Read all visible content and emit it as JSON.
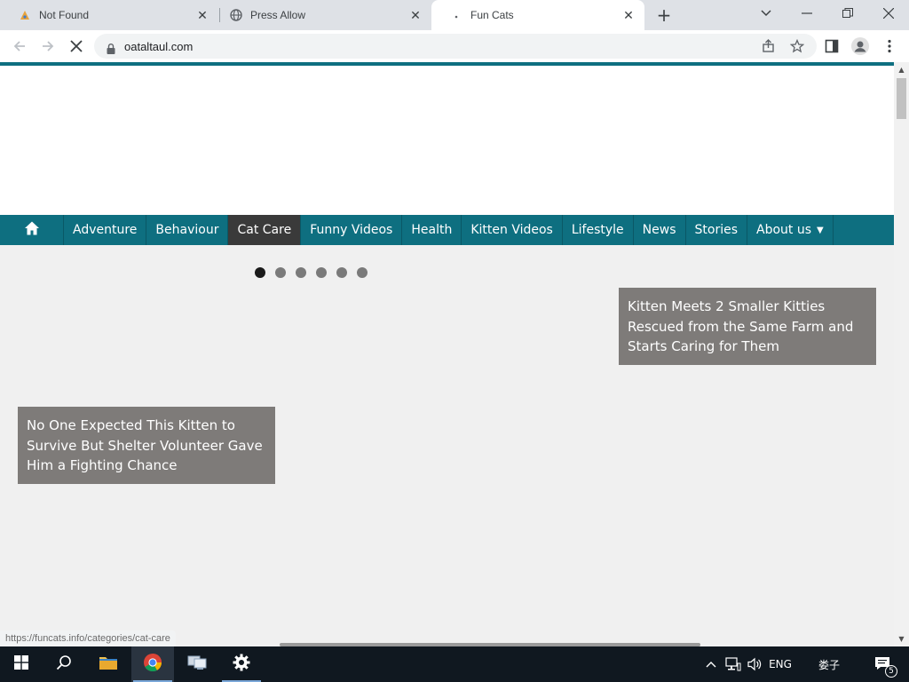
{
  "browser": {
    "tabs": [
      {
        "title": "Not Found",
        "icon": "error-page-icon"
      },
      {
        "title": "Press Allow",
        "icon": "globe-icon"
      },
      {
        "title": "Fun Cats",
        "icon": "loading-icon",
        "active": true
      }
    ],
    "url": "oataltaul.com",
    "status_url": "https://funcats.info/categories/cat-care"
  },
  "page": {
    "nav": {
      "items": [
        "Adventure",
        "Behaviour",
        "Cat Care",
        "Funny Videos",
        "Health",
        "Kitten Videos",
        "Lifestyle",
        "News",
        "Stories",
        "About us"
      ],
      "active": "Cat Care",
      "accent": "#0e6f80"
    },
    "slider": {
      "dots": 6,
      "active_dot": 1
    },
    "captions": [
      "Kitten Meets 2 Smaller Kitties Rescued from the Same Farm and Starts Caring for Them",
      "No One Expected This Kitten to Survive But Shelter Volunteer Gave Him a Fighting Chance"
    ]
  },
  "taskbar": {
    "language": "ENG",
    "ime": "娄子",
    "notification_count": "5"
  }
}
